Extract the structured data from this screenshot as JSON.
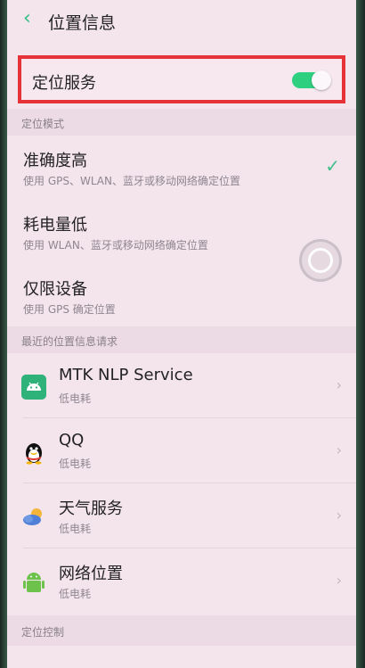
{
  "header": {
    "title": "位置信息",
    "back_icon": "chevron-left-icon"
  },
  "location_service": {
    "label": "定位服务",
    "enabled": true,
    "accent": "#2fcf80"
  },
  "mode_section": {
    "title": "定位模式"
  },
  "modes": [
    {
      "title": "准确度高",
      "subtitle": "使用 GPS、WLAN、蓝牙或移动网络确定位置",
      "selected": true
    },
    {
      "title": "耗电量低",
      "subtitle": "使用 WLAN、蓝牙或移动网络确定位置",
      "selected": false
    },
    {
      "title": "仅限设备",
      "subtitle": "使用 GPS 确定位置",
      "selected": false
    }
  ],
  "recent_section": {
    "title": "最近的位置信息请求"
  },
  "recent_apps": [
    {
      "name": "MTK NLP Service",
      "usage": "低电耗",
      "icon": "android-robot-icon"
    },
    {
      "name": "QQ",
      "usage": "低电耗",
      "icon": "qq-penguin-icon"
    },
    {
      "name": "天气服务",
      "usage": "低电耗",
      "icon": "weather-cloud-sun-icon"
    },
    {
      "name": "网络位置",
      "usage": "低电耗",
      "icon": "android-robot-icon"
    }
  ],
  "control_section": {
    "title": "定位控制"
  }
}
